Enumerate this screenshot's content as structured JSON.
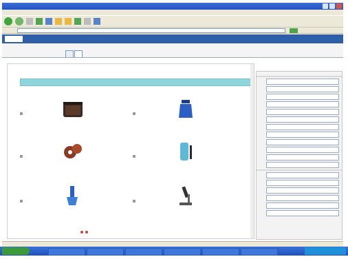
{
  "window": {
    "title": "",
    "controls": [
      "minimize-icon",
      "maximize-icon",
      "close-icon"
    ]
  },
  "menu": {
    "items": []
  },
  "toolbar": {
    "buttons": [
      "back-icon",
      "forward-icon",
      "stop-icon",
      "refresh-icon",
      "home-icon",
      "search-icon",
      "favorites-icon",
      "history-icon",
      "mail-icon",
      "print-icon"
    ]
  },
  "address": {
    "value": ""
  },
  "app": {
    "title": ""
  },
  "subheader": {
    "label": "",
    "tabs": [
      {
        "label": ""
      },
      {
        "label": ""
      }
    ]
  },
  "breadcrumb": {
    "text": ""
  },
  "content": {
    "banner": "",
    "items": [
      {
        "icon": "box-icon",
        "caption": ""
      },
      {
        "icon": "jar-icon",
        "caption": ""
      },
      {
        "icon": "gears-icon",
        "caption": ""
      },
      {
        "icon": "cylinder-icon",
        "caption": ""
      },
      {
        "icon": "pipette-icon",
        "caption": ""
      },
      {
        "icon": "microscope-icon",
        "caption": ""
      }
    ]
  },
  "sidebar": {
    "top_text": "",
    "sections": [
      {
        "title": "",
        "items": [
          "",
          "",
          "",
          "",
          "",
          "",
          "",
          "",
          "",
          "",
          "",
          ""
        ]
      },
      {
        "title": "",
        "items": [
          "",
          "",
          "",
          "",
          "",
          ""
        ]
      }
    ]
  },
  "colors": {
    "titlebar": "#2453c4",
    "appbar": "#2f5fa8",
    "banner": "#8fd6dc",
    "link": "#2a58a8",
    "taskbar": "#2150c0"
  }
}
